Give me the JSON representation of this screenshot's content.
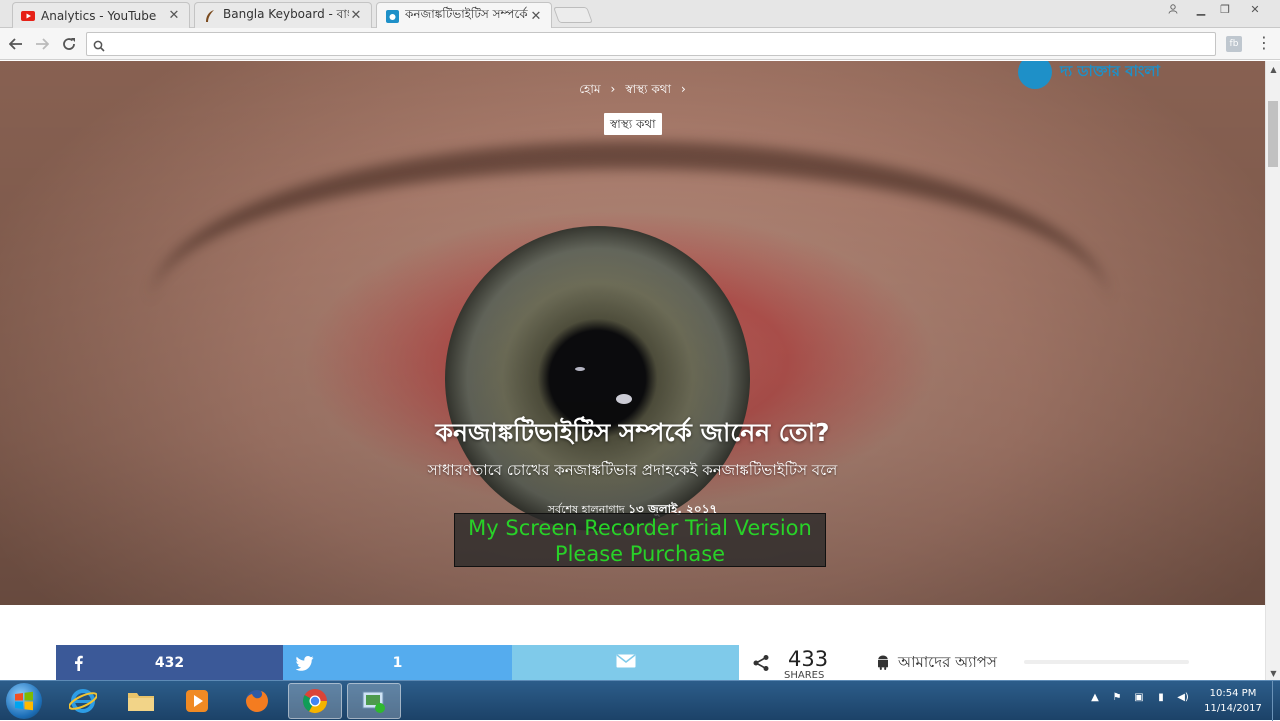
{
  "browser": {
    "tabs": [
      {
        "title": "Analytics - YouTube",
        "icon": "youtube-icon",
        "active": false
      },
      {
        "title": "Bangla Keyboard - বাংলা",
        "icon": "quill-icon",
        "active": false
      },
      {
        "title": "কনজাঙ্কটিভাইটিস সম্পর্কে জা",
        "icon": "site-favicon",
        "active": true
      }
    ],
    "address_value": "",
    "colors": {
      "fb": "#3b5998",
      "tw": "#55acee",
      "email": "#7fcaea",
      "brand": "#1e90c8"
    }
  },
  "page": {
    "logo_text": "দ্য ডাক্তার বাংলা",
    "breadcrumb": [
      "হোম",
      "›",
      "স্বাস্থ্য কথা",
      "›"
    ],
    "category": "স্বাস্থ্য কথা",
    "headline": "কনজাঙ্কটিভাইটিস সম্পর্কে জানেন তো?",
    "subheadline": "সাধারণতাবে চোখের কনজাঙ্কটিভার প্রদাহকেই কনজাঙ্কটিভাইটিস বলে",
    "updated_label": "সর্বশেষ হালনাগাদ",
    "updated_date": "১৩ জুলাই, ২০১৭"
  },
  "watermark": {
    "line1": "My Screen Recorder Trial Version",
    "line2": "Please Purchase"
  },
  "share": {
    "facebook_count": "432",
    "twitter_count": "1",
    "total": "433",
    "total_label": "SHARES",
    "apps_label": "আমাদের অ্যাপস"
  },
  "taskbar": {
    "time": "10:54 PM",
    "date": "11/14/2017"
  }
}
